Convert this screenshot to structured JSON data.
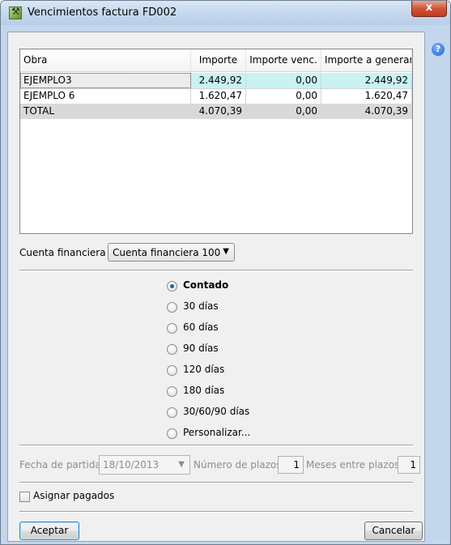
{
  "window": {
    "title": "Vencimientos factura FD002",
    "close_glyph": "x",
    "help_glyph": "?"
  },
  "table": {
    "headers": [
      "Obra",
      "Importe",
      "Importe venc.",
      "Importe a generar"
    ],
    "rows": [
      [
        "EJEMPLO3",
        "2.449,92",
        "0,00",
        "2.449,92"
      ],
      [
        "EJEMPLO 6",
        "1.620,47",
        "0,00",
        "1.620,47"
      ],
      [
        "TOTAL",
        "4.070,39",
        "0,00",
        "4.070,39"
      ]
    ]
  },
  "cuenta": {
    "label": "Cuenta financiera",
    "value": "Cuenta financiera 100"
  },
  "options": {
    "selected": "Contado",
    "items": [
      "Contado",
      "30 días",
      "60 días",
      "90 días",
      "120 días",
      "180 días",
      "30/60/90 días",
      "Personalizar..."
    ]
  },
  "plazos": {
    "fecha_label": "Fecha de partida",
    "fecha_value": "18/10/2013",
    "numero_label": "Número de plazos",
    "numero_value": "1",
    "meses_label": "Meses entre plazos",
    "meses_value": "1"
  },
  "asignar": {
    "label": "Asignar pagados",
    "checked": false
  },
  "buttons": {
    "accept": "Aceptar",
    "cancel": "Cancelar"
  },
  "icons": {
    "app": "app-icon",
    "help": "help-icon",
    "close": "close-icon",
    "dropdown": "chevron-down-icon"
  },
  "colors": {
    "selected_row": "#c9f2f2",
    "total_row": "#d9d9d9",
    "radio_dot": "#1e5eb4",
    "window_frame": "#c3d6ec"
  }
}
